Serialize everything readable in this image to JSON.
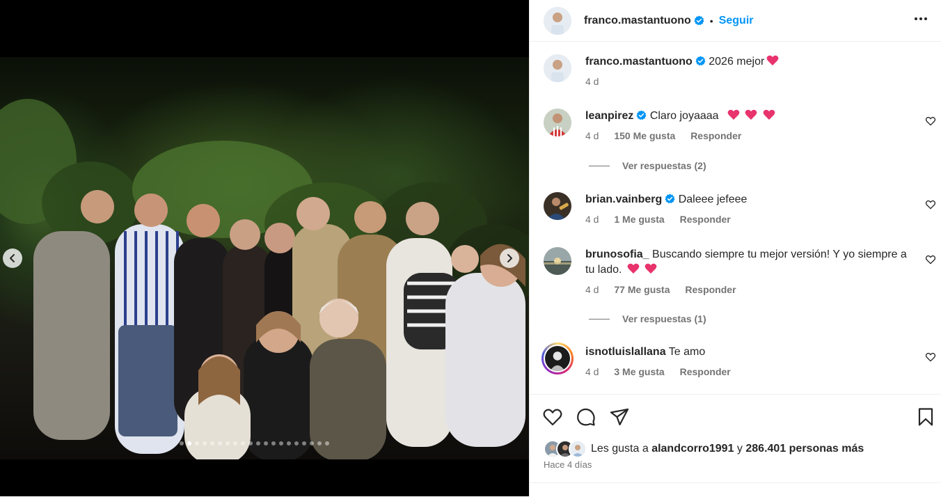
{
  "post": {
    "author": "franco.mastantuono",
    "follow_label": "Seguir",
    "separator": "•",
    "caption": "2026 mejor",
    "caption_time": "4 d",
    "slide_count": 20,
    "active_slide": 2
  },
  "comments": [
    {
      "user": "leanpirez",
      "verified": true,
      "text": "Claro joyaaaa",
      "hearts": 3,
      "time": "4 d",
      "likes": "150 Me gusta",
      "reply": "Responder",
      "view_replies": "Ver respuestas (2)"
    },
    {
      "user": "brian.vainberg",
      "verified": true,
      "text": "Daleee jefeee",
      "hearts": 0,
      "time": "4 d",
      "likes": "1 Me gusta",
      "reply": "Responder"
    },
    {
      "user": "brunosofia_",
      "verified": false,
      "text": "Buscando siempre tu mejor versión! Y yo siempre a tu lado.",
      "hearts": 2,
      "time": "4 d",
      "likes": "77 Me gusta",
      "reply": "Responder",
      "view_replies": "Ver respuestas (1)"
    },
    {
      "user": "isnotluislallana",
      "verified": false,
      "text": "Te amo",
      "hearts": 0,
      "time": "4 d",
      "likes": "3 Me gusta",
      "reply": "Responder"
    }
  ],
  "likes": {
    "prefix": "Les gusta a",
    "user": "alandcorro1991",
    "connector": "y",
    "others": "286.401 personas más"
  },
  "posted_ago": "Hace 4 días",
  "icons": {
    "like": "heart-icon",
    "comment": "comment-icon",
    "share": "share-icon",
    "save": "bookmark-icon",
    "more": "more-options-icon",
    "verified": "verified-badge-icon",
    "prev": "chevron-left-icon",
    "next": "chevron-right-icon"
  },
  "colors": {
    "link": "#0095f6",
    "verified": "#0095f6",
    "heart_emoji": "#e8336d",
    "meta": "#737373"
  }
}
